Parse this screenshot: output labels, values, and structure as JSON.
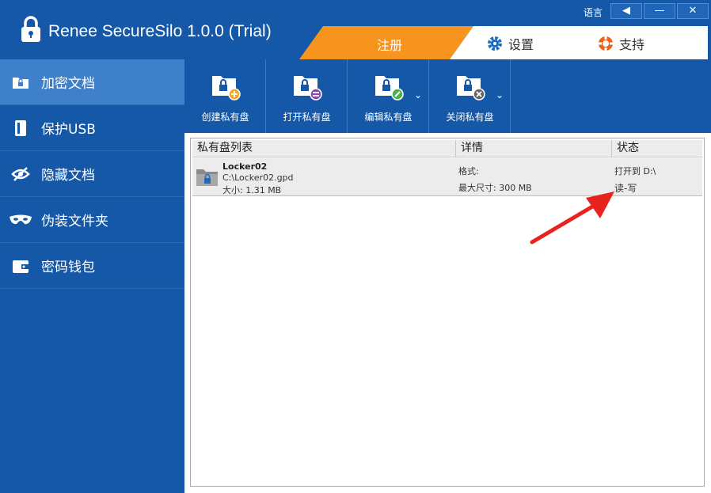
{
  "app": {
    "title": "Renee SecureSilo 1.0.0 (Trial)"
  },
  "window": {
    "language_label": "语言",
    "lang_btn": "◀",
    "minimize": "—",
    "close": "✕"
  },
  "tabs": {
    "register": "注册",
    "settings": "设置",
    "support": "支持"
  },
  "sidebar": {
    "items": [
      {
        "label": "加密文档",
        "icon": "encrypted-file-icon",
        "active": true
      },
      {
        "label": "保护USB",
        "icon": "usb-icon",
        "active": false
      },
      {
        "label": "隐藏文档",
        "icon": "hidden-eye-icon",
        "active": false
      },
      {
        "label": "伪装文件夹",
        "icon": "mask-icon",
        "active": false
      },
      {
        "label": "密码钱包",
        "icon": "wallet-icon",
        "active": false
      }
    ]
  },
  "toolbar": {
    "buttons": [
      {
        "label": "创建私有盘",
        "icon": "create-locker-icon",
        "badge": "+",
        "badge_color": "#f5a623",
        "has_dropdown": false
      },
      {
        "label": "打开私有盘",
        "icon": "open-locker-icon",
        "badge": "=",
        "badge_color": "#8e44ad",
        "has_dropdown": false
      },
      {
        "label": "编辑私有盘",
        "icon": "edit-locker-icon",
        "badge": "✎",
        "badge_color": "#4caf50",
        "has_dropdown": true
      },
      {
        "label": "关闭私有盘",
        "icon": "close-locker-icon",
        "badge": "✕",
        "badge_color": "#666666",
        "has_dropdown": true
      }
    ]
  },
  "list": {
    "columns": [
      "私有盘列表",
      "详情",
      "状态"
    ],
    "rows": [
      {
        "name": "Locker02",
        "path": "C:\\Locker02.gpd",
        "size": "大小: 1.31 MB",
        "format": "格式:",
        "max_size": "最大尺寸: 300 MB",
        "status_open": "打开到 D:\\",
        "status_rw": "读-写"
      }
    ]
  },
  "colors": {
    "primary": "#1558a8",
    "active": "#3f80cb",
    "register_tab": "#f7941d",
    "annotation_arrow": "#e8231f"
  }
}
